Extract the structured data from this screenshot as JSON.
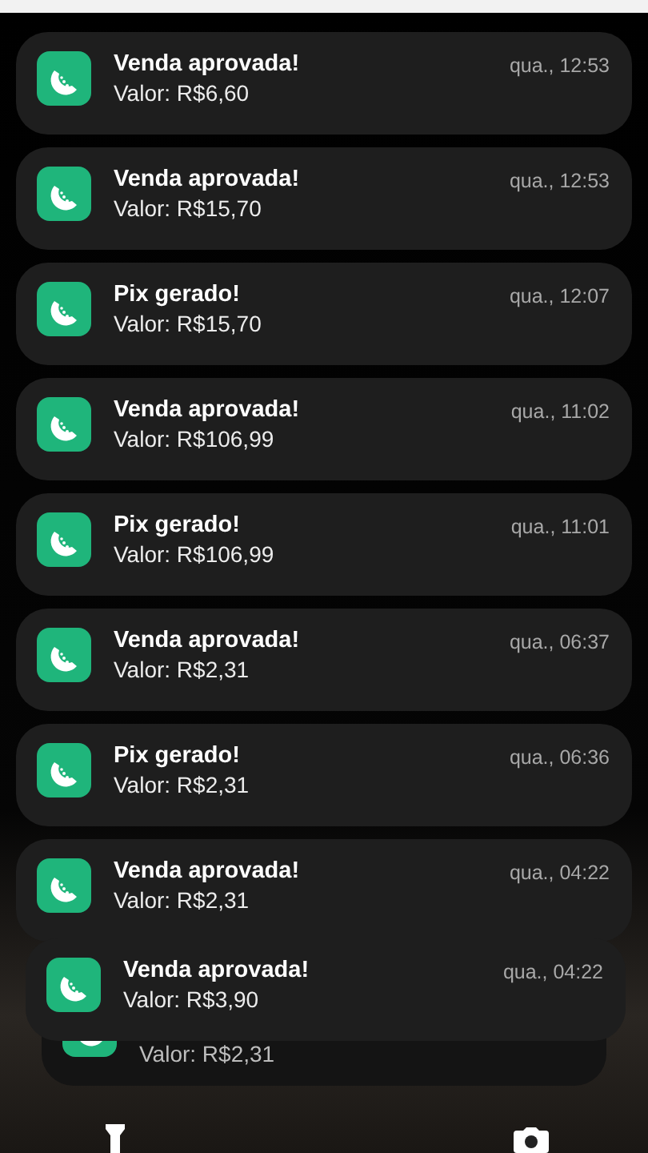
{
  "notifications": [
    {
      "title": "Venda aprovada!",
      "body": "Valor: R$6,60",
      "time": "qua., 12:53",
      "stacked": false
    },
    {
      "title": "Venda aprovada!",
      "body": "Valor: R$15,70",
      "time": "qua., 12:53",
      "stacked": false
    },
    {
      "title": "Pix gerado!",
      "body": "Valor: R$15,70",
      "time": "qua., 12:07",
      "stacked": false
    },
    {
      "title": "Venda aprovada!",
      "body": "Valor: R$106,99",
      "time": "qua., 11:02",
      "stacked": false
    },
    {
      "title": "Pix gerado!",
      "body": "Valor: R$106,99",
      "time": "qua., 11:01",
      "stacked": false
    },
    {
      "title": "Venda aprovada!",
      "body": "Valor: R$2,31",
      "time": "qua., 06:37",
      "stacked": false
    },
    {
      "title": "Pix gerado!",
      "body": "Valor: R$2,31",
      "time": "qua., 06:36",
      "stacked": false
    },
    {
      "title": "Venda aprovada!",
      "body": "Valor: R$2,31",
      "time": "qua., 04:22",
      "stacked": false
    },
    {
      "title": "Venda aprovada!",
      "body": "Valor: R$3,90",
      "time": "qua., 04:22",
      "stacked": true
    }
  ],
  "stacked_below": {
    "body": "Valor: R$2,31"
  }
}
